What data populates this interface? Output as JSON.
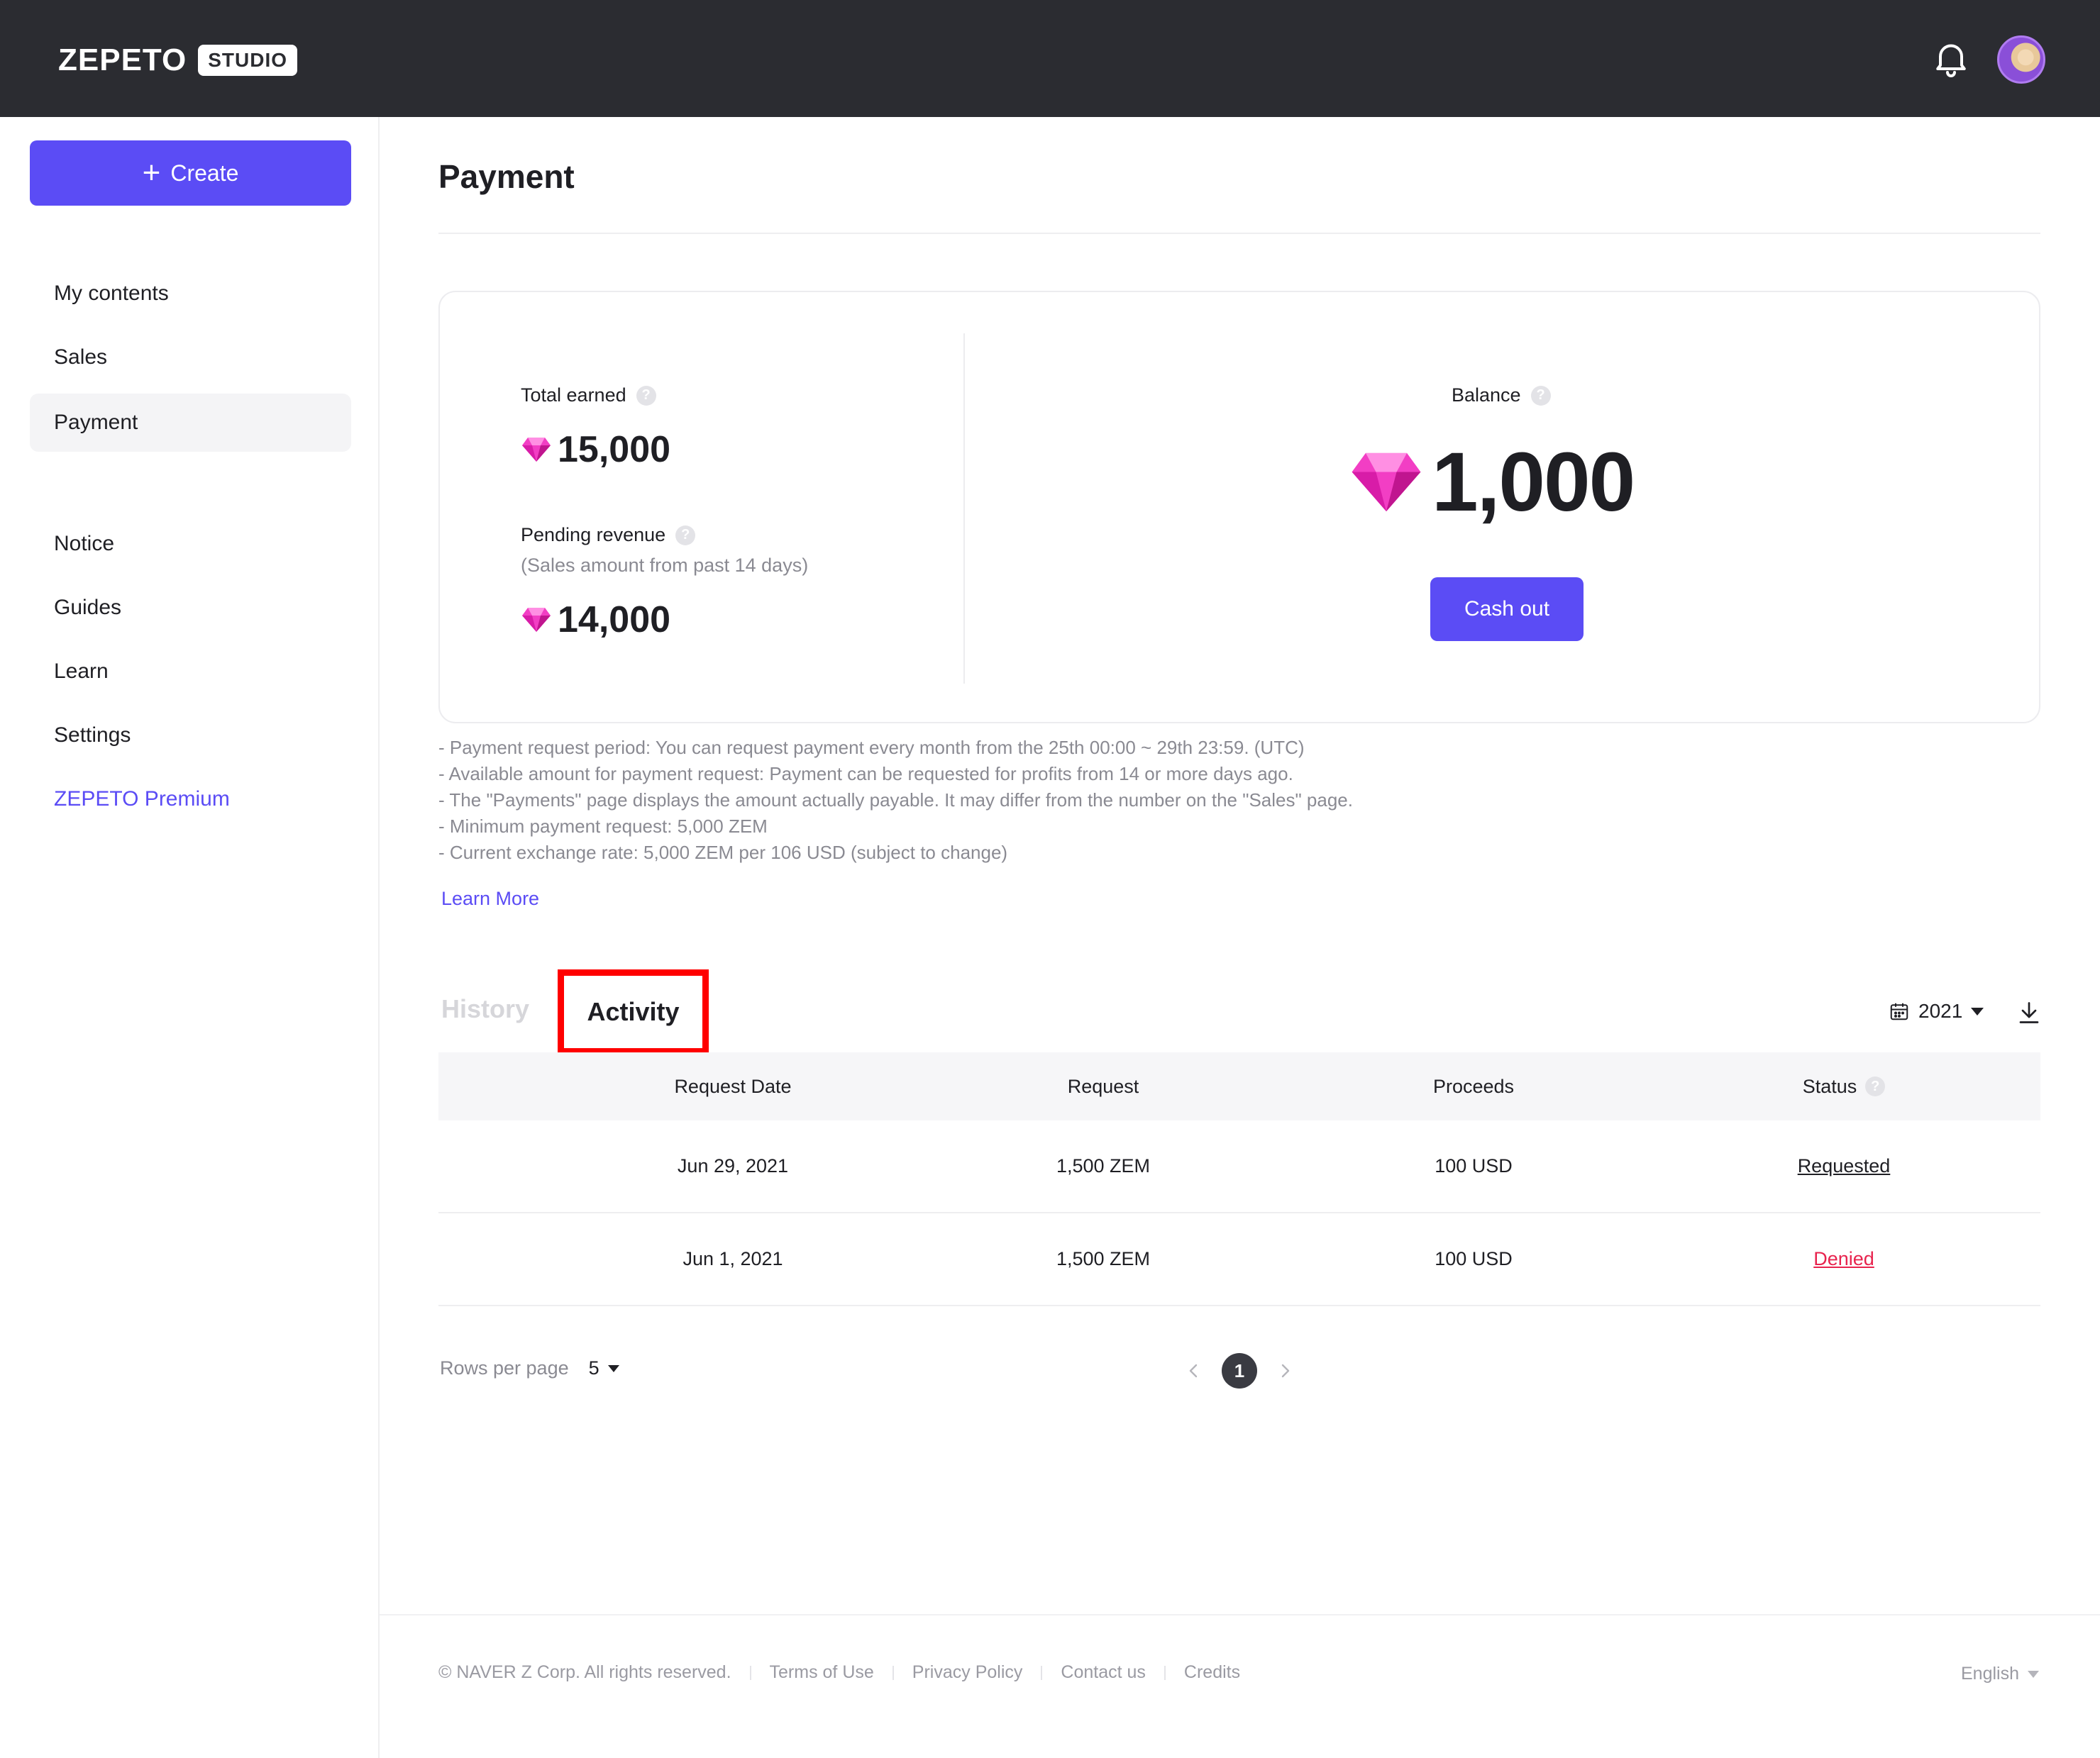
{
  "header": {
    "logo_text": "ZEPETO",
    "logo_badge": "STUDIO",
    "bell_icon": "bell-icon",
    "avatar_icon": "avatar"
  },
  "sidebar": {
    "create_label": "Create",
    "items": [
      {
        "label": "My contents"
      },
      {
        "label": "Sales"
      },
      {
        "label": "Payment"
      },
      {
        "label": "Notice"
      },
      {
        "label": "Guides"
      },
      {
        "label": "Learn"
      },
      {
        "label": "Settings"
      },
      {
        "label": "ZEPETO Premium"
      }
    ]
  },
  "page": {
    "title": "Payment"
  },
  "summary": {
    "total_earned_label": "Total earned",
    "total_earned_value": "15,000",
    "pending_label": "Pending revenue",
    "pending_sub": "(Sales amount from past 14 days)",
    "pending_value": "14,000",
    "balance_label": "Balance",
    "balance_value": "1,000",
    "cashout_label": "Cash out",
    "help_glyph": "?"
  },
  "notes": [
    "- Payment request period: You can request payment every month from the 25th 00:00 ~ 29th 23:59. (UTC)",
    "- Available amount for payment request: Payment can be requested for profits from 14 or more days ago.",
    "- The \"Payments\" page displays the amount actually payable. It may differ from the number on the \"Sales\" page.",
    "- Minimum payment request: 5,000 ZEM",
    "- Current exchange rate: 5,000 ZEM per 106 USD (subject to change)"
  ],
  "learn_more": "Learn More",
  "tabs": {
    "history": "History",
    "activity": "Activity"
  },
  "year_filter": "2021",
  "table": {
    "headers": [
      "Request Date",
      "Request",
      "Proceeds",
      "Status"
    ],
    "rows": [
      {
        "date": "Jun 29, 2021",
        "request": "1,500 ZEM",
        "proceeds": "100 USD",
        "status": "Requested"
      },
      {
        "date": "Jun 1, 2021",
        "request": "1,500 ZEM",
        "proceeds": "100 USD",
        "status": "Denied"
      }
    ]
  },
  "pagination": {
    "rows_per_page_label": "Rows per page",
    "rows_per_page_value": "5",
    "current_page": "1"
  },
  "footer": {
    "copyright": "© NAVER Z Corp. All rights reserved.",
    "links": [
      "Terms of Use",
      "Privacy Policy",
      "Contact us",
      "Credits"
    ],
    "language": "English"
  },
  "colors": {
    "accent": "#5b4cf5",
    "header_bg": "#2b2c31",
    "denied": "#e8234e",
    "highlight_box": "#ff0000"
  }
}
